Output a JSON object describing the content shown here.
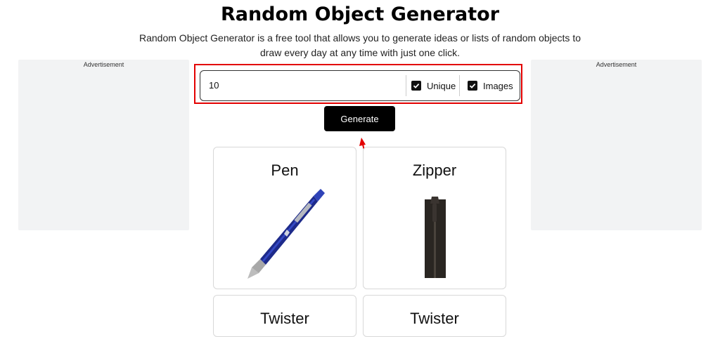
{
  "page": {
    "title": "Random Object Generator",
    "description": "Random Object Generator is a free tool that allows you to generate ideas or lists of random objects to draw every day at any time with just one click."
  },
  "ads": {
    "left_label": "Advertisement",
    "right_label": "Advertisement"
  },
  "controls": {
    "quantity_value": "10",
    "unique_label": "Unique",
    "unique_checked": true,
    "images_label": "Images",
    "images_checked": true,
    "generate_label": "Generate",
    "highlight_color": "#e30000"
  },
  "results": [
    {
      "name": "Pen",
      "image": "pen-image"
    },
    {
      "name": "Zipper",
      "image": "zipper-image"
    },
    {
      "name": "Twister",
      "image": ""
    },
    {
      "name": "Twister",
      "image": ""
    }
  ]
}
